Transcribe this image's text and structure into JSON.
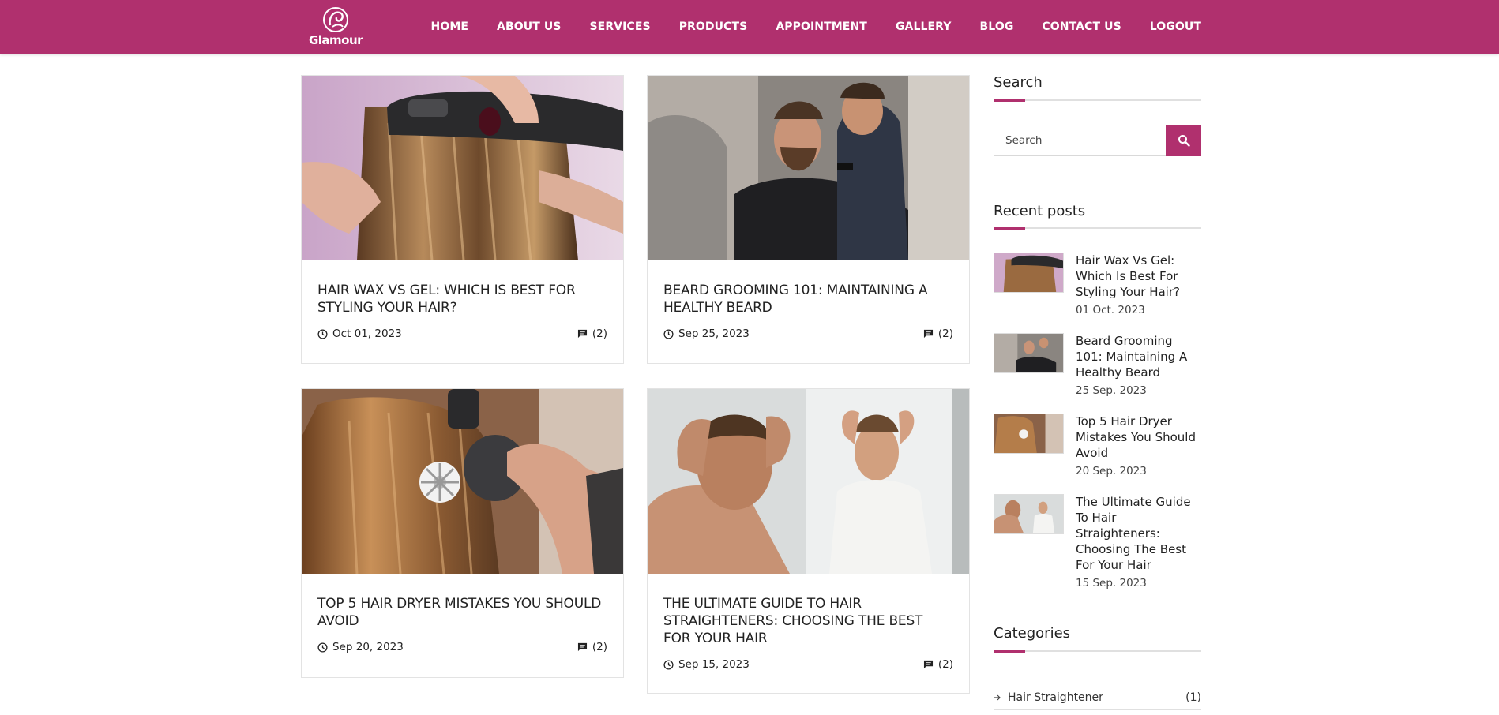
{
  "brand": {
    "name": "Glamour",
    "accent": "#b0306e"
  },
  "nav": {
    "items": [
      "HOME",
      "ABOUT US",
      "SERVICES",
      "PRODUCTS",
      "APPOINTMENT",
      "GALLERY",
      "BLOG",
      "CONTACT US",
      "LOGOUT"
    ]
  },
  "posts": [
    {
      "title": "HAIR WAX VS GEL: WHICH IS BEST FOR STYLING YOUR HAIR?",
      "date": "Oct 01, 2023",
      "comments": "(2)"
    },
    {
      "title": "BEARD GROOMING 101: MAINTAINING A HEALTHY BEARD",
      "date": "Sep 25, 2023",
      "comments": "(2)"
    },
    {
      "title": "TOP 5 HAIR DRYER MISTAKES YOU SHOULD AVOID",
      "date": "Sep 20, 2023",
      "comments": "(2)"
    },
    {
      "title": "THE ULTIMATE GUIDE TO HAIR STRAIGHTENERS: CHOOSING THE BEST FOR YOUR HAIR",
      "date": "Sep 15, 2023",
      "comments": "(2)"
    }
  ],
  "sidebar": {
    "search": {
      "title": "Search",
      "placeholder": "Search"
    },
    "recent": {
      "title": "Recent posts",
      "items": [
        {
          "title": "Hair Wax Vs Gel: Which Is Best For Styling Your Hair?",
          "date": "01 Oct. 2023"
        },
        {
          "title": "Beard Grooming 101: Maintaining A Healthy Beard",
          "date": "25 Sep. 2023"
        },
        {
          "title": "Top 5 Hair Dryer Mistakes You Should Avoid",
          "date": "20 Sep. 2023"
        },
        {
          "title": "The Ultimate Guide To Hair Straighteners: Choosing The Best For Your Hair",
          "date": "15 Sep. 2023"
        }
      ]
    },
    "categories": {
      "title": "Categories",
      "items": [
        {
          "name": "Hair Straightener",
          "count": "(1)"
        }
      ]
    }
  },
  "icons": {
    "search": "search-icon",
    "clock": "clock-icon",
    "comment": "comment-icon",
    "arrow": "arrow-right-icon"
  }
}
